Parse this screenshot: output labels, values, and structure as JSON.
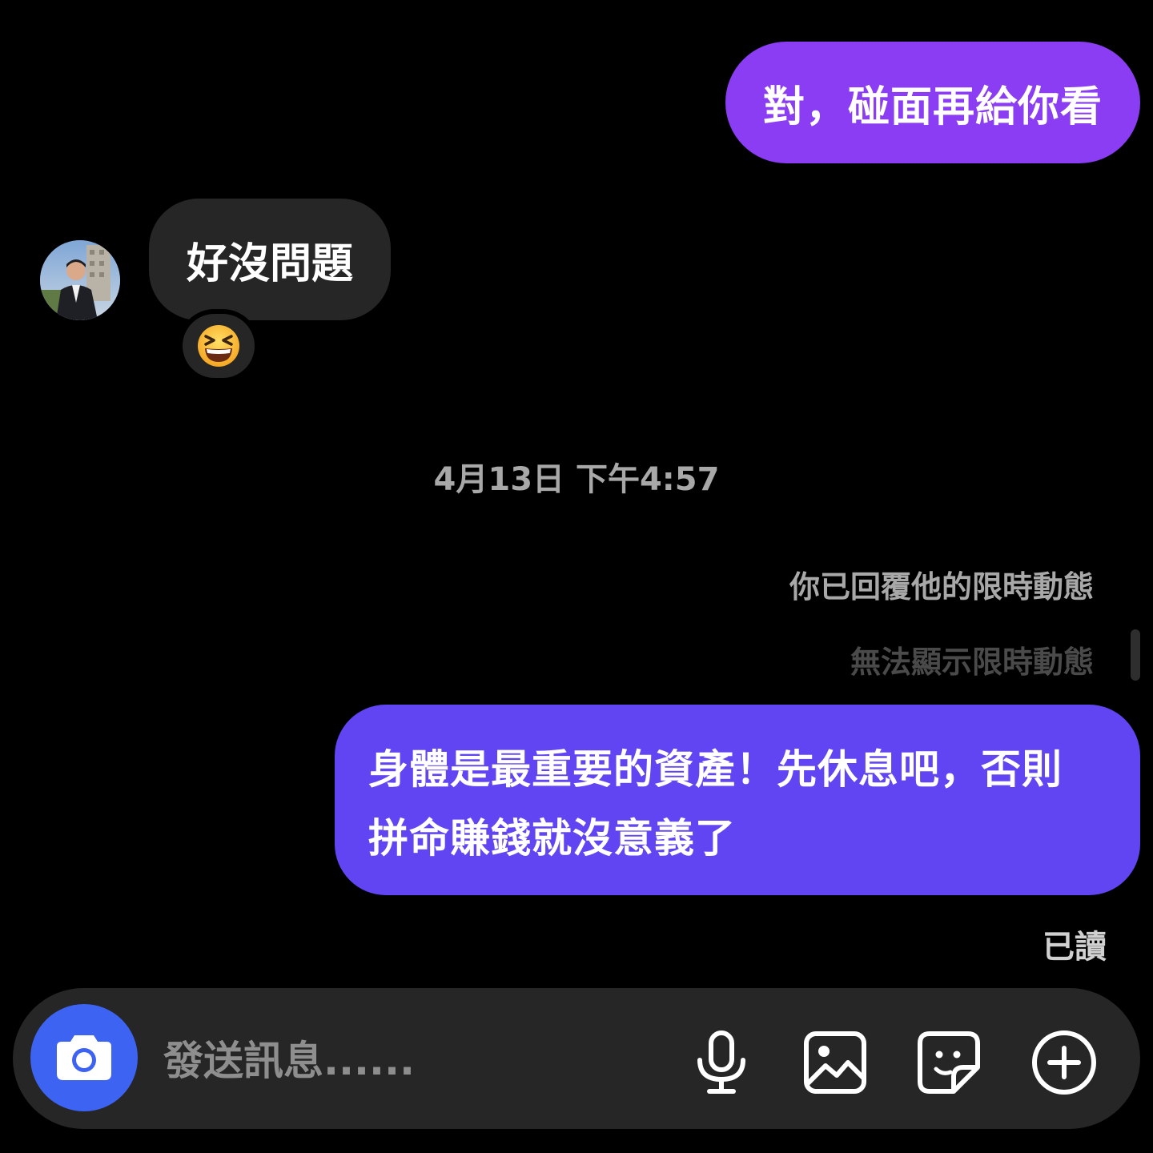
{
  "messages": {
    "outgoing_1": "對，碰面再給你看",
    "incoming_1": "好沒問題",
    "reaction_icon": "grinning-squinting-face-emoji",
    "timestamp": "4月13日 下午4:57",
    "story_reply_note": "你已回覆他的限時動態",
    "story_unavailable": "無法顯示限時動態",
    "outgoing_2_line_1": "身體是最重要的資產！先休息吧，否則",
    "outgoing_2_line_2": "拼命賺錢就沒意義了",
    "read_receipt": "已讀"
  },
  "composer": {
    "placeholder": "發送訊息......",
    "value": "",
    "icons": [
      "camera-icon",
      "microphone-icon",
      "image-icon",
      "sticker-icon",
      "plus-circle-icon"
    ]
  },
  "colors": {
    "background": "#000000",
    "outgoing_bubble_1": "#8a3df2",
    "outgoing_bubble_2": "#6145f2",
    "incoming_bubble": "#262626",
    "camera_button": "#3d63f2",
    "composer": "#262626"
  }
}
